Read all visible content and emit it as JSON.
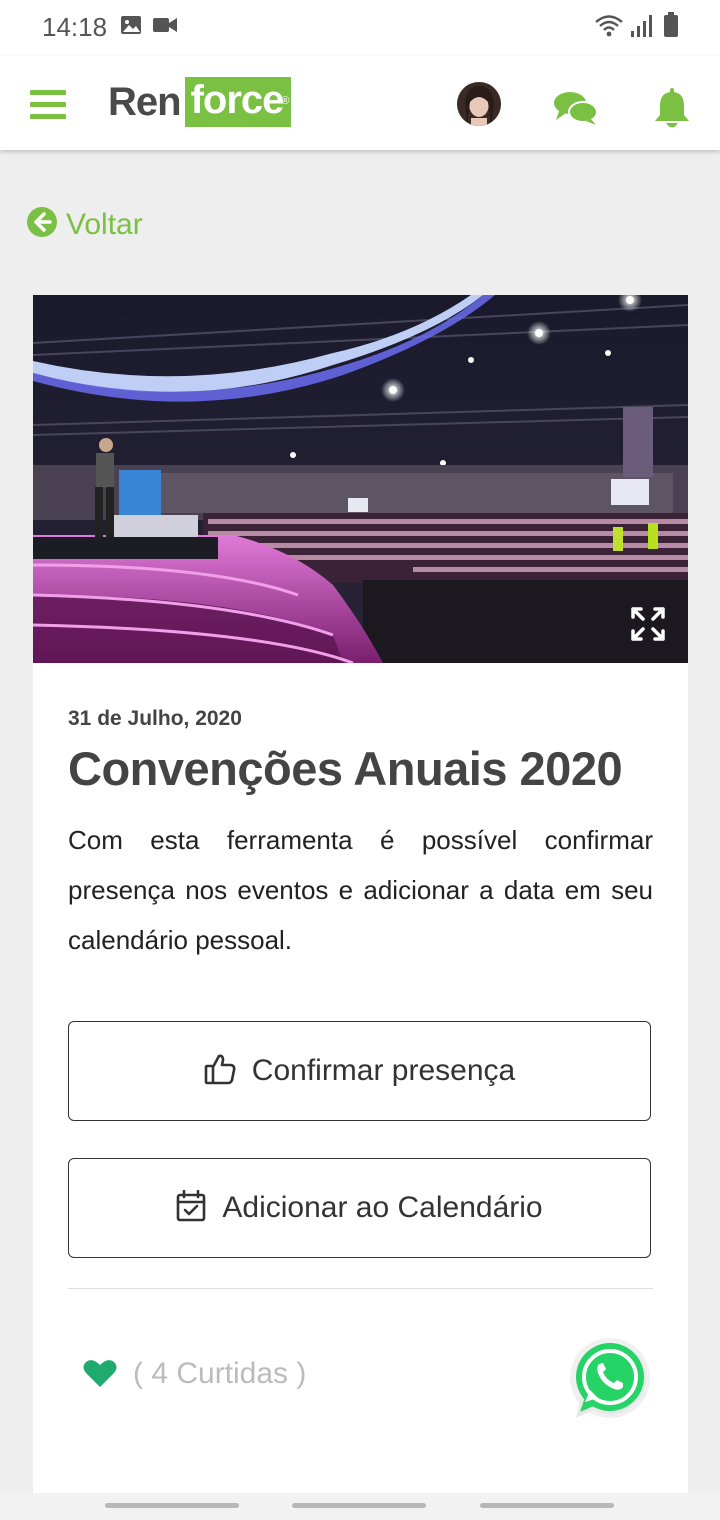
{
  "status_bar": {
    "time": "14:18",
    "icons": [
      "image-icon",
      "video-icon",
      "wifi-icon",
      "signal-icon",
      "battery-icon"
    ]
  },
  "header": {
    "logo": {
      "part1": "Ren",
      "part2": "force",
      "reg": "®"
    },
    "icons": [
      "menu-icon",
      "chat-icon",
      "bell-icon"
    ]
  },
  "back": {
    "label": "Voltar"
  },
  "article": {
    "date": "31 de Julho, 2020",
    "title": "Convenções Anuais 2020",
    "description": "Com esta ferramenta é possível confirmar presença nos eventos e adicionar a data em seu calendário pessoal.",
    "confirm_label": "Confirmar presença",
    "calendar_label": "Adicionar ao Calendário",
    "likes_label": "( 4 Curtidas )"
  },
  "colors": {
    "accent": "#7ac143",
    "heart": "#1fab6e",
    "whatsapp": "#25d366"
  }
}
